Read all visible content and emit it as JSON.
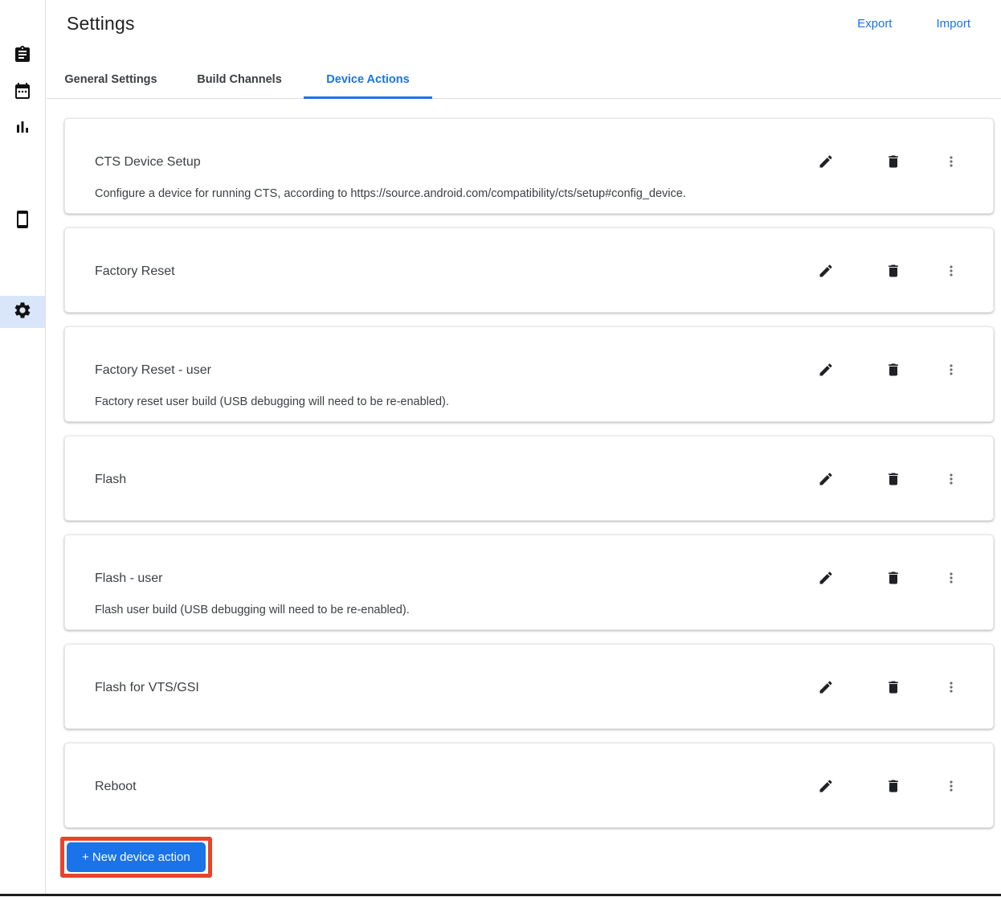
{
  "page": {
    "title": "Settings"
  },
  "header": {
    "export_label": "Export",
    "import_label": "Import"
  },
  "sidebar": {
    "items": [
      {
        "icon": "assignment-icon"
      },
      {
        "icon": "calendar-icon"
      },
      {
        "icon": "bar-chart-icon"
      },
      {
        "icon": "smartphone-icon"
      },
      {
        "icon": "settings-gear-icon",
        "selected": true
      }
    ]
  },
  "tabs": [
    {
      "label": "General Settings",
      "active": false
    },
    {
      "label": "Build Channels",
      "active": false
    },
    {
      "label": "Device Actions",
      "active": true
    }
  ],
  "device_actions": [
    {
      "title": "CTS Device Setup",
      "description": "Configure a device for running CTS, according to https://source.android.com/compatibility/cts/setup#config_device."
    },
    {
      "title": "Factory Reset",
      "description": ""
    },
    {
      "title": "Factory Reset - user",
      "description": "Factory reset user build (USB debugging will need to be re-enabled)."
    },
    {
      "title": "Flash",
      "description": ""
    },
    {
      "title": "Flash - user",
      "description": "Flash user build (USB debugging will need to be re-enabled)."
    },
    {
      "title": "Flash for VTS/GSI",
      "description": ""
    },
    {
      "title": "Reboot",
      "description": ""
    }
  ],
  "actions": {
    "new_device_action_label": "+ New device action"
  },
  "colors": {
    "accent": "#1a73e8",
    "highlight_box": "#e8432b",
    "sidebar_selected_bg": "#d9e6fa"
  }
}
